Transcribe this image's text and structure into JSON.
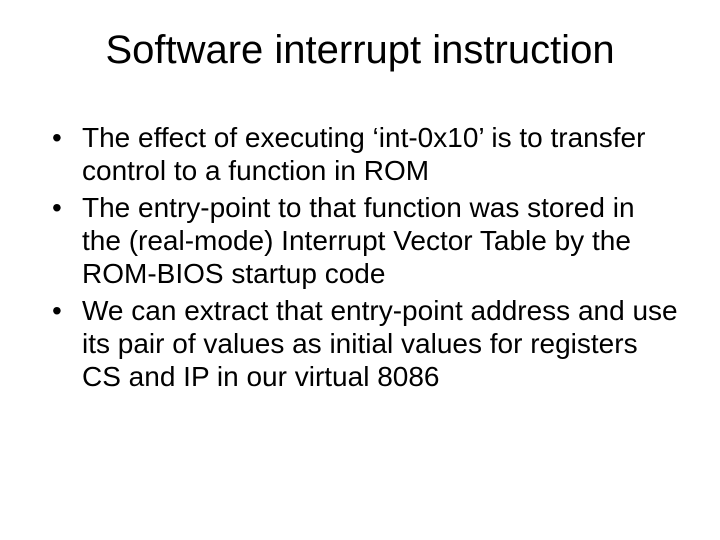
{
  "title": "Software interrupt instruction",
  "bullets": [
    "The effect of executing ‘int-0x10’ is to transfer control to a function in ROM",
    "The entry-point to that function was stored in the (real-mode) Interrupt Vector Table by the ROM-BIOS startup code",
    "We can extract that entry-point address and use its pair of values as initial values for registers CS and IP in our virtual 8086"
  ]
}
